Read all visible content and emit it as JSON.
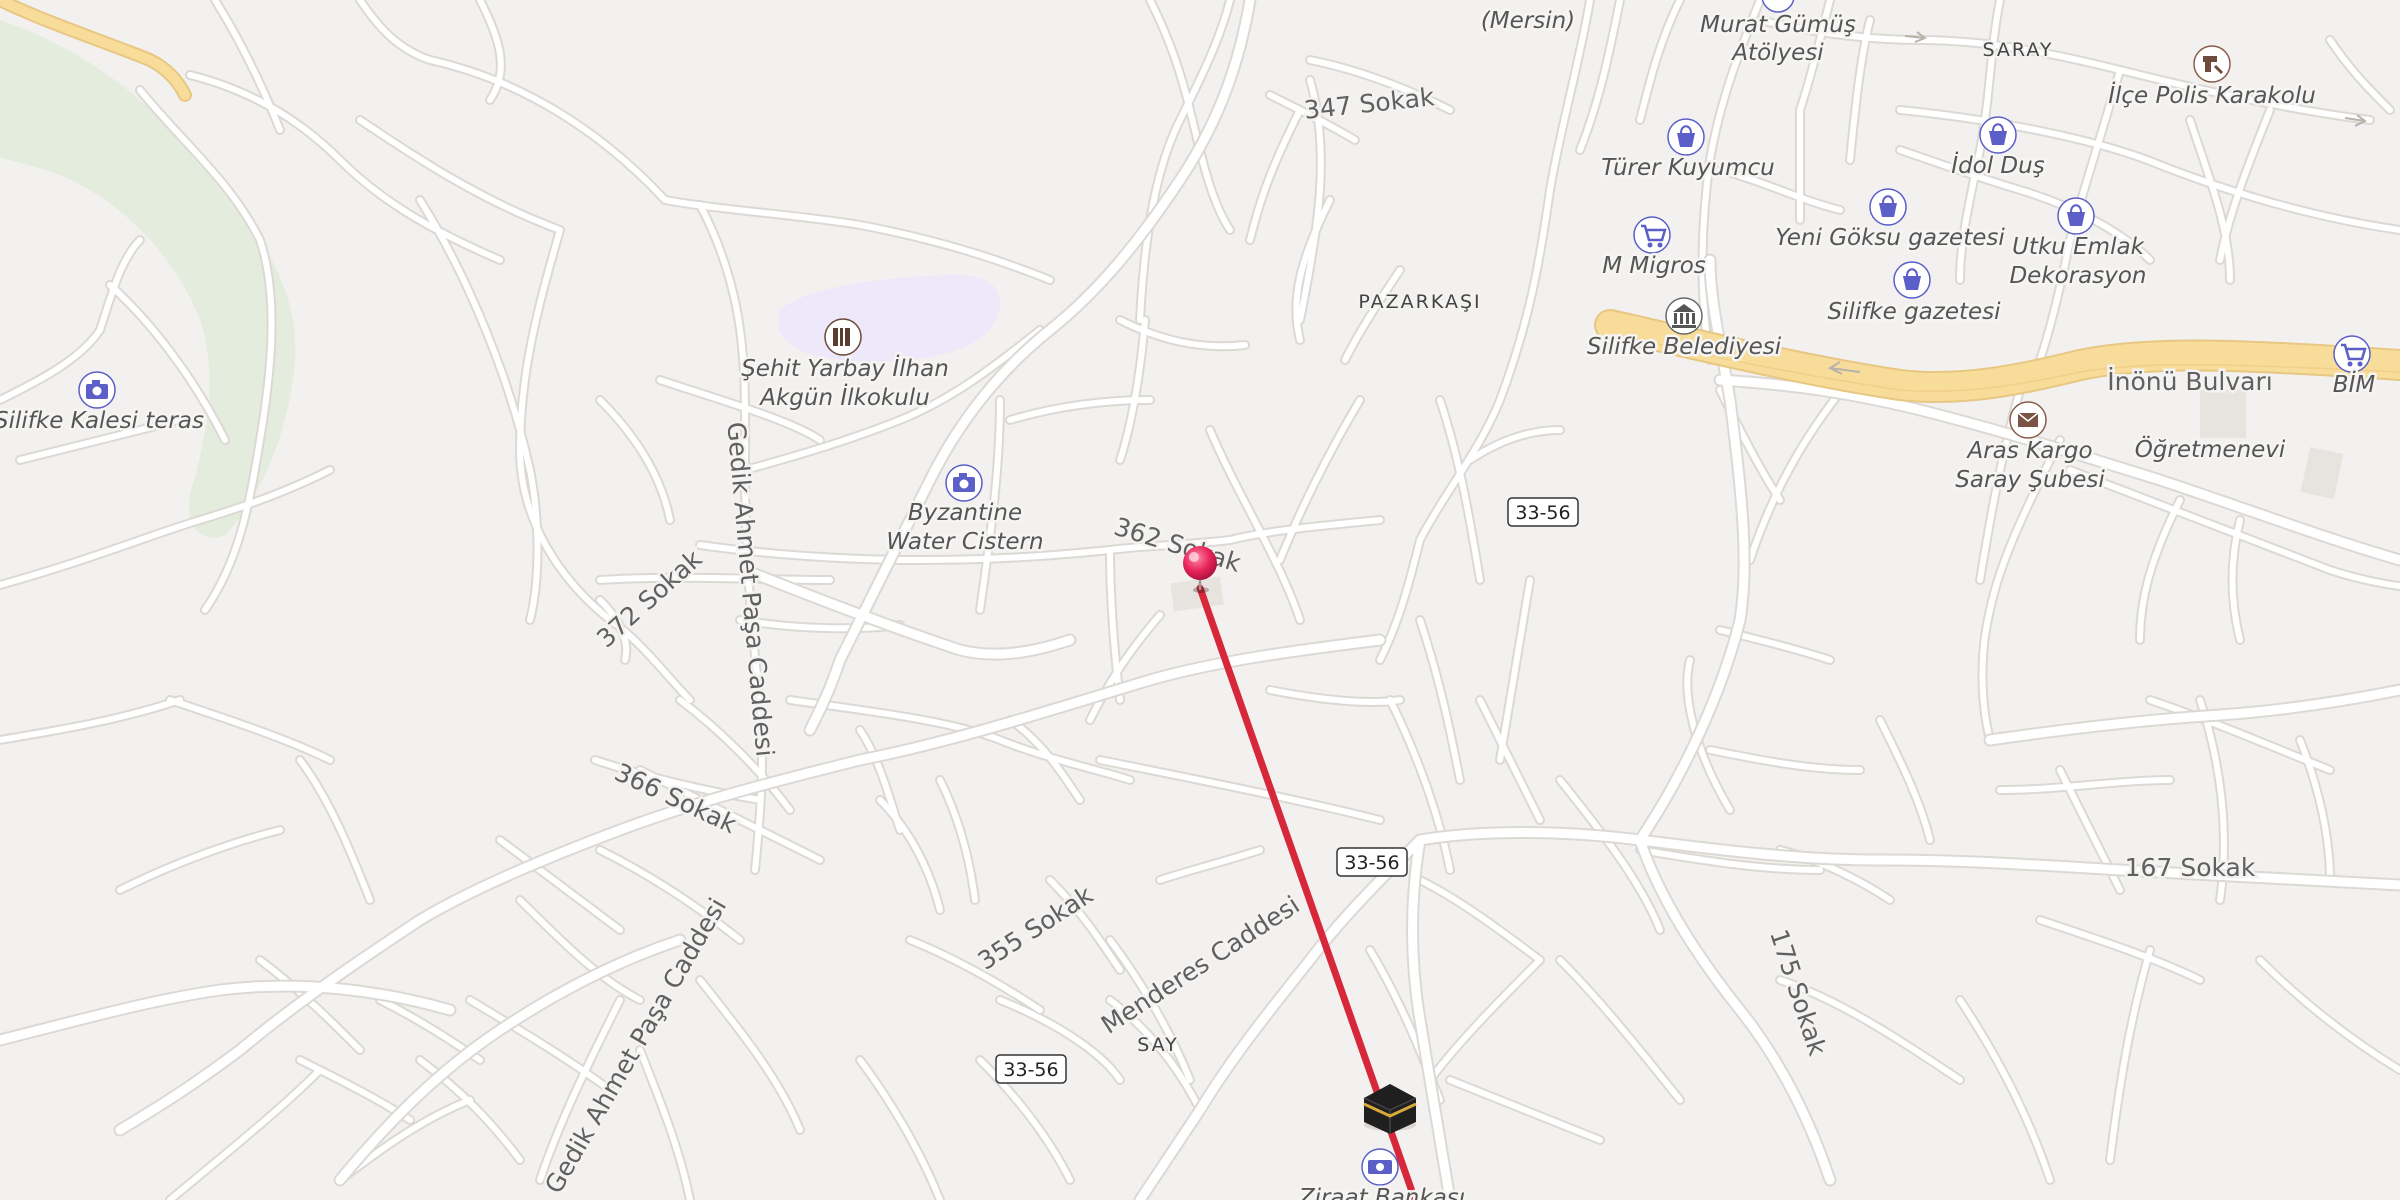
{
  "map": {
    "colors": {
      "background": "#f3f1ef",
      "road": "#ffffff",
      "road_outline": "#dedbd7",
      "main_road": "#f7dc9a",
      "route": "#d6283a",
      "poi": "#5b5fc7",
      "park": "#e4ecdd",
      "school": "#ede8fa"
    },
    "areas": [
      {
        "id": "area-saray",
        "label": "SARAY"
      },
      {
        "id": "area-pazarkasi",
        "label": "PAZARKAŞI"
      },
      {
        "id": "area-say",
        "label": "SAY"
      }
    ],
    "streets": [
      {
        "id": "street-347-sokak",
        "label": "347 Sokak"
      },
      {
        "id": "street-362-sokak",
        "label": "362 Sokak"
      },
      {
        "id": "street-372-sokak",
        "label": "372 Sokak"
      },
      {
        "id": "street-366-sokak",
        "label": "366 Sokak"
      },
      {
        "id": "street-355-sokak",
        "label": "355 Sokak"
      },
      {
        "id": "street-menderes-caddesi",
        "label": "Menderes Caddesi"
      },
      {
        "id": "street-gedik-ahmet-north",
        "label": "Gedik Ahmet Paşa Caddesi"
      },
      {
        "id": "street-gedik-ahmet-south",
        "label": "Gedik Ahmet Paşa Caddesi"
      },
      {
        "id": "street-167-sokak",
        "label": "167 Sokak"
      },
      {
        "id": "street-175-sokak",
        "label": "175 Sokak"
      },
      {
        "id": "street-inonu-bulvari",
        "label": "İnönü Bulvarı"
      }
    ],
    "road_shields": [
      {
        "id": "shield-1",
        "label": "33-56"
      },
      {
        "id": "shield-2",
        "label": "33-56"
      },
      {
        "id": "shield-3",
        "label": "33-56"
      }
    ],
    "pois": [
      {
        "id": "poi-mersin",
        "icon": "none",
        "lines": [
          "(Mersin)"
        ]
      },
      {
        "id": "poi-murat-gumus",
        "icon": "shopping-bag-icon",
        "lines": [
          "Murat Gümüş",
          "Atölyesi"
        ]
      },
      {
        "id": "poi-ilce-polis",
        "icon": "police-icon",
        "lines": [
          "İlçe Polis Karakolu"
        ]
      },
      {
        "id": "poi-turer-kuyumcu",
        "icon": "shopping-bag-icon",
        "lines": [
          "Türer Kuyumcu"
        ]
      },
      {
        "id": "poi-idol-dus",
        "icon": "shopping-bag-icon",
        "lines": [
          "İdol Duş"
        ]
      },
      {
        "id": "poi-yeni-goksu",
        "icon": "shopping-bag-icon",
        "lines": [
          "Yeni Göksu gazetesi"
        ]
      },
      {
        "id": "poi-m-migros",
        "icon": "cart-icon",
        "lines": [
          "M Migros"
        ]
      },
      {
        "id": "poi-utku-emlak",
        "icon": "shopping-bag-icon",
        "lines": [
          "Utku Emlak",
          "Dekorasyon"
        ]
      },
      {
        "id": "poi-silifke-gazetesi",
        "icon": "shopping-bag-icon",
        "lines": [
          "Silifke gazetesi"
        ]
      },
      {
        "id": "poi-silifke-belediyesi",
        "icon": "town-hall-icon",
        "lines": [
          "Silifke Belediyesi"
        ]
      },
      {
        "id": "poi-bim",
        "icon": "cart-icon",
        "lines": [
          "BİM"
        ]
      },
      {
        "id": "poi-aras-kargo",
        "icon": "mail-icon",
        "lines": [
          "Aras Kargo",
          "Saray Şubesi"
        ]
      },
      {
        "id": "poi-ogretmenevi",
        "icon": "none",
        "lines": [
          "Öğretmenevi"
        ]
      },
      {
        "id": "poi-sehit-yarbay",
        "icon": "school-icon",
        "lines": [
          "Şehit Yarbay İlhan",
          "Akgün İlkokulu"
        ]
      },
      {
        "id": "poi-byzantine-cistern",
        "icon": "camera-icon",
        "lines": [
          "Byzantine",
          "Water Cistern"
        ]
      },
      {
        "id": "poi-silifke-kalesi",
        "icon": "camera-icon",
        "lines": [
          "Silifke Kalesi teras"
        ]
      },
      {
        "id": "poi-ziraat-bankasi",
        "icon": "banknote-icon",
        "lines": [
          "Ziraat Bankası"
        ]
      },
      {
        "id": "poi-mosque",
        "icon": "kaaba-icon",
        "lines": []
      }
    ],
    "route": {
      "color": "#d6283a"
    },
    "pin": {
      "color": "#e8245a"
    }
  }
}
